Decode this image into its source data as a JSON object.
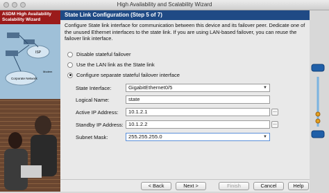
{
  "window": {
    "title": "High Availability and Scalability Wizard"
  },
  "sidebar": {
    "header_line1": "ASDM High Availability",
    "header_line2": "Scalability Wizard",
    "net_labels": {
      "isp": "ISP",
      "corp": "Corporate Network",
      "modem": "Modem"
    }
  },
  "step": {
    "title": "State Link Configuration (Step 5 of 7)"
  },
  "description": "Configure State link interface for communication between this device and its failover peer. Dedicate one of the unused Ethernet interfaces to the state link. If you are using LAN-based failover, you can reuse the failover link interface.",
  "options": [
    {
      "label": "Disable stateful failover",
      "selected": false
    },
    {
      "label": "Use the LAN link as the State link",
      "selected": false
    },
    {
      "label": "Configure separate stateful failover interface",
      "selected": true
    }
  ],
  "form": {
    "state_interface_label": "State Interface:",
    "state_interface_value": "GigabitEthernet0/5",
    "logical_name_label": "Logical Name:",
    "logical_name_value": "state",
    "active_ip_label": "Active IP Address:",
    "active_ip_value": "10.1.2.1",
    "standby_ip_label": "Standby IP Address:",
    "standby_ip_value": "10.1.2.2",
    "subnet_mask_label": "Subnet Mask:",
    "subnet_mask_value": "255.255.255.0",
    "browse_glyph": "..."
  },
  "buttons": {
    "back": "< Back",
    "next": "Next >",
    "finish": "Finish",
    "cancel": "Cancel",
    "help": "Help"
  }
}
